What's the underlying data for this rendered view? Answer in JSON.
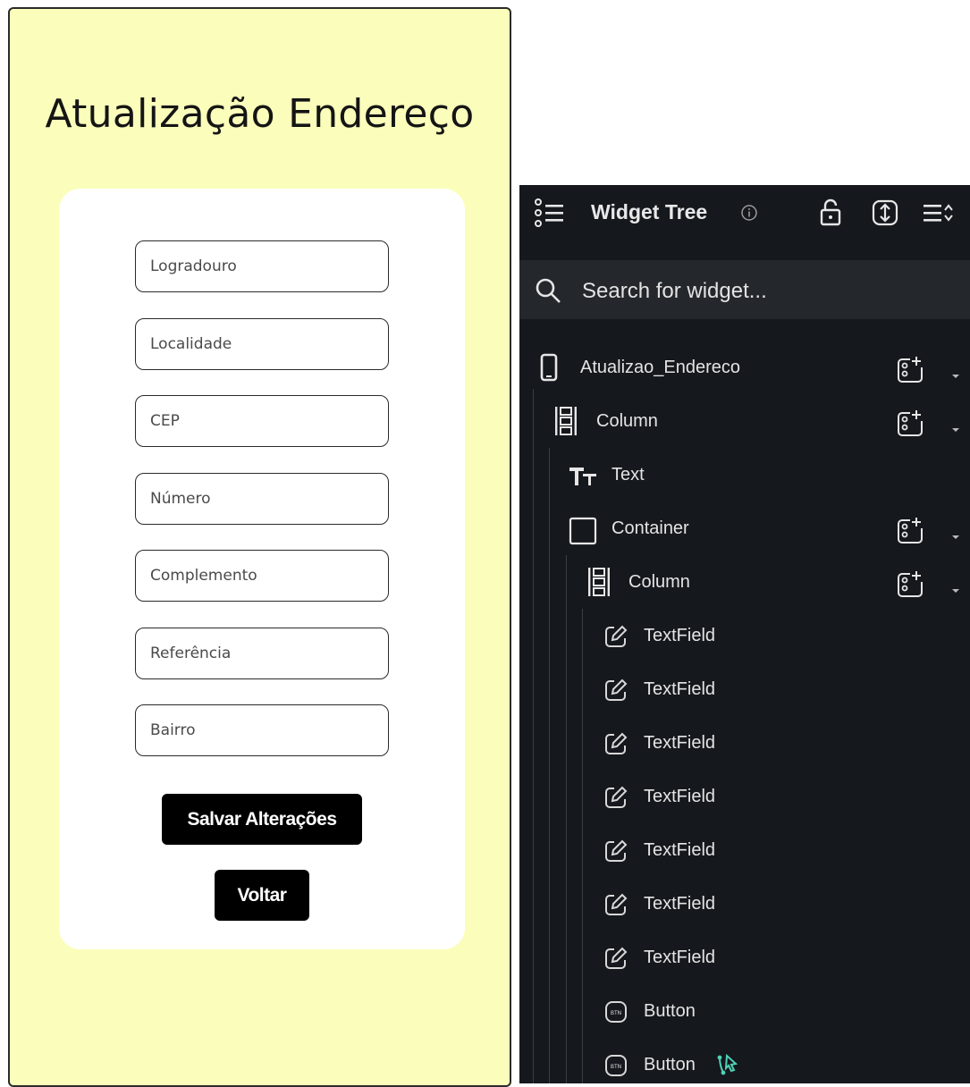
{
  "preview": {
    "title": "Atualização Endereço",
    "fields": [
      {
        "placeholder": "Logradouro"
      },
      {
        "placeholder": "Localidade"
      },
      {
        "placeholder": "CEP"
      },
      {
        "placeholder": "Número"
      },
      {
        "placeholder": "Complemento"
      },
      {
        "placeholder": "Referência"
      },
      {
        "placeholder": "Bairro"
      }
    ],
    "save_label": "Salvar Alterações",
    "back_label": "Voltar",
    "colors": {
      "background": "#fbfebb",
      "card": "#ffffff",
      "button": "#000000"
    }
  },
  "widget_tree": {
    "title": "Widget Tree",
    "search_placeholder": "Search for widget...",
    "header_icons": [
      "tree-list-icon",
      "info-icon",
      "unlock-icon",
      "expand-vertical-icon",
      "sort-icon"
    ],
    "nodes": [
      {
        "label": "Atualizao_Endereco",
        "icon": "phone-icon",
        "add_child": true
      },
      {
        "label": "Column",
        "icon": "column-icon",
        "add_child": true
      },
      {
        "label": "Text",
        "icon": "text-icon",
        "add_child": false
      },
      {
        "label": "Container",
        "icon": "container-icon",
        "add_child": true
      },
      {
        "label": "Column",
        "icon": "column-icon",
        "add_child": true
      },
      {
        "label": "TextField",
        "icon": "edit-icon",
        "add_child": false
      },
      {
        "label": "TextField",
        "icon": "edit-icon",
        "add_child": false
      },
      {
        "label": "TextField",
        "icon": "edit-icon",
        "add_child": false
      },
      {
        "label": "TextField",
        "icon": "edit-icon",
        "add_child": false
      },
      {
        "label": "TextField",
        "icon": "edit-icon",
        "add_child": false
      },
      {
        "label": "TextField",
        "icon": "edit-icon",
        "add_child": false
      },
      {
        "label": "TextField",
        "icon": "edit-icon",
        "add_child": false
      },
      {
        "label": "Button",
        "icon": "button-icon",
        "add_child": false
      },
      {
        "label": "Button",
        "icon": "button-icon",
        "add_child": false,
        "action_icon": "action-flow-icon"
      }
    ],
    "colors": {
      "panel": "#15181d",
      "search": "#24272c",
      "action": "#4fd1b5"
    }
  }
}
